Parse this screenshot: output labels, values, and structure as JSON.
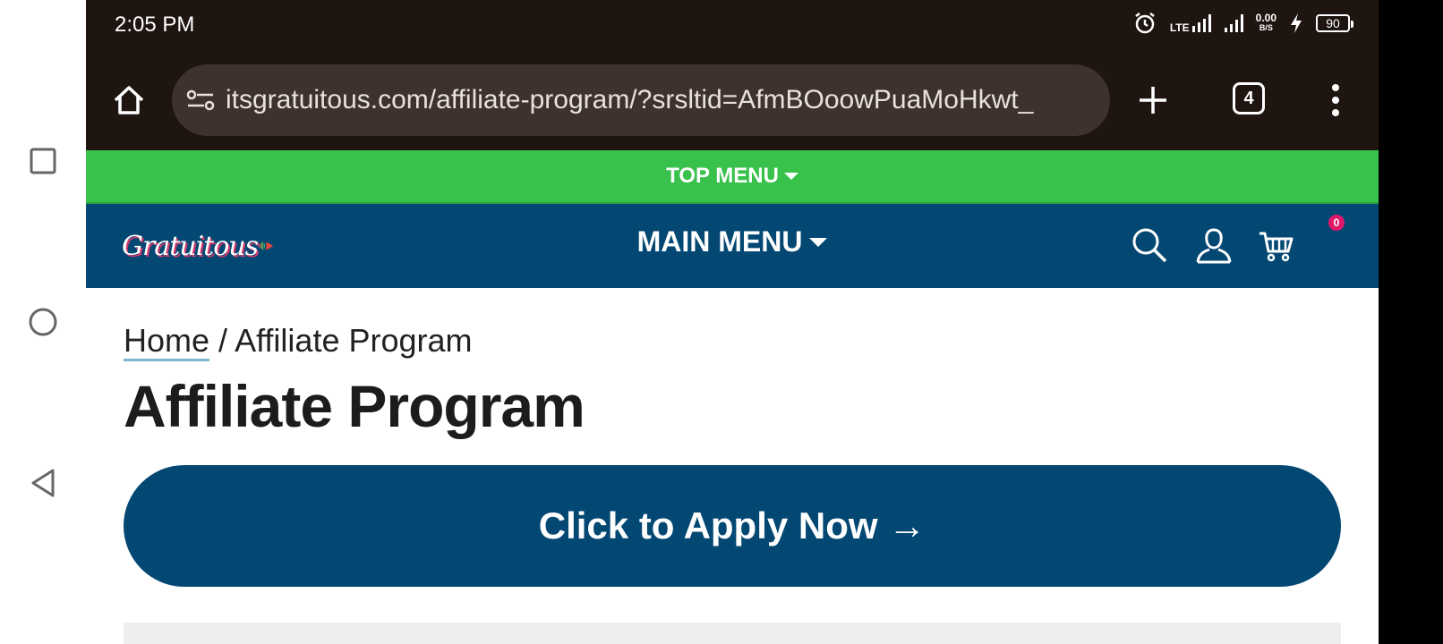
{
  "status_bar": {
    "time": "2:05 PM",
    "network_label": "LTE",
    "speed_value": "0.00",
    "speed_unit": "B/S",
    "battery": "90"
  },
  "browser": {
    "url": "itsgratuitous.com/affiliate-program/?srsltid=AfmBOoowPuaMoHkwt_",
    "tab_count": "4"
  },
  "site": {
    "top_menu_label": "TOP MENU",
    "logo_text": "Gratuitous",
    "main_menu_label": "MAIN MENU",
    "cart_count": "0"
  },
  "page": {
    "breadcrumb_home": "Home",
    "breadcrumb_separator": " / ",
    "breadcrumb_current": "Affiliate Program",
    "title": "Affiliate Program",
    "apply_button": "Click to Apply Now →"
  },
  "colors": {
    "top_menu_bg": "#38c14b",
    "main_nav_bg": "#034773",
    "browser_chrome_bg": "#1e1410",
    "cart_badge": "#e0186c"
  }
}
